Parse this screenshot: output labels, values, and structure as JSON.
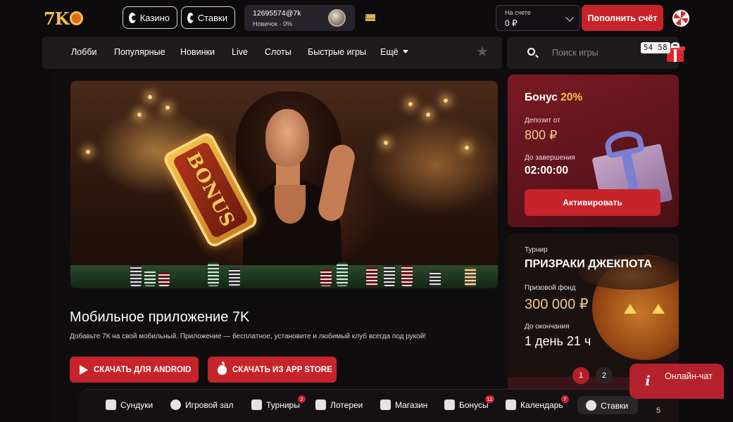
{
  "header": {
    "logo_text": "7K",
    "casino_label": "Казино",
    "bets_label": "Ставки",
    "user": {
      "id": "12695574@7k",
      "rank": "Новичок · 0%"
    },
    "balance": {
      "label": "На счете",
      "value": "0 ₽"
    },
    "deposit_label": "Пополнить счёт"
  },
  "nav": {
    "items": [
      "Лобби",
      "Популярные",
      "Новинки",
      "Live",
      "Слоты",
      "Быстрые игры"
    ],
    "more_label": "Ещё"
  },
  "search": {
    "placeholder": "Поиск игры"
  },
  "gift_timer": "54 58",
  "hero": {
    "card_text": "BONUS"
  },
  "promo": {
    "title": "Мобильное приложение 7K",
    "description": "Добавьте 7К на свой мобильный. Приложение — бесплатное, установите и любимый клуб всегда под рукой!",
    "android_label": "СКАЧАТЬ ДЛЯ ANDROID",
    "apple_label": "СКАЧАТЬ ИЗ APP STORE"
  },
  "bonus": {
    "title_prefix": "Бонус",
    "title_pct": "20%",
    "deposit_label": "Депозит от",
    "deposit_value": "800 ₽",
    "end_label": "До завершения",
    "end_value": "02:00:00",
    "activate_label": "Активировать"
  },
  "tournament": {
    "label": "Турнир",
    "title": "ПРИЗРАКИ ДЖЕКПОТА",
    "prize_label": "Призовой фонд",
    "prize_value": "300 000 ₽",
    "end_label": "До окончания",
    "end_value": "1 день  21 ч",
    "pages": [
      "1",
      "2"
    ]
  },
  "chat": {
    "label": "Онлайн-чат"
  },
  "bottom_bar": {
    "items": [
      {
        "label": "Сундуки",
        "icon": "chest-icon"
      },
      {
        "label": "Игровой зал",
        "icon": "chip-icon"
      },
      {
        "label": "Турниры",
        "icon": "trophy-icon",
        "badge": "2"
      },
      {
        "label": "Лотереи",
        "icon": "ticket-icon"
      },
      {
        "label": "Магазин",
        "icon": "bag-icon"
      },
      {
        "label": "Бонусы",
        "icon": "gift-icon",
        "badge": "12"
      },
      {
        "label": "Календарь",
        "icon": "calendar-icon",
        "badge": "7"
      },
      {
        "label": "Ставки",
        "icon": "ball-icon"
      }
    ],
    "stray_text": "5"
  },
  "colors": {
    "accent": "#c6232b",
    "gold": "#f2c14a",
    "background": "#0c0a0b"
  }
}
